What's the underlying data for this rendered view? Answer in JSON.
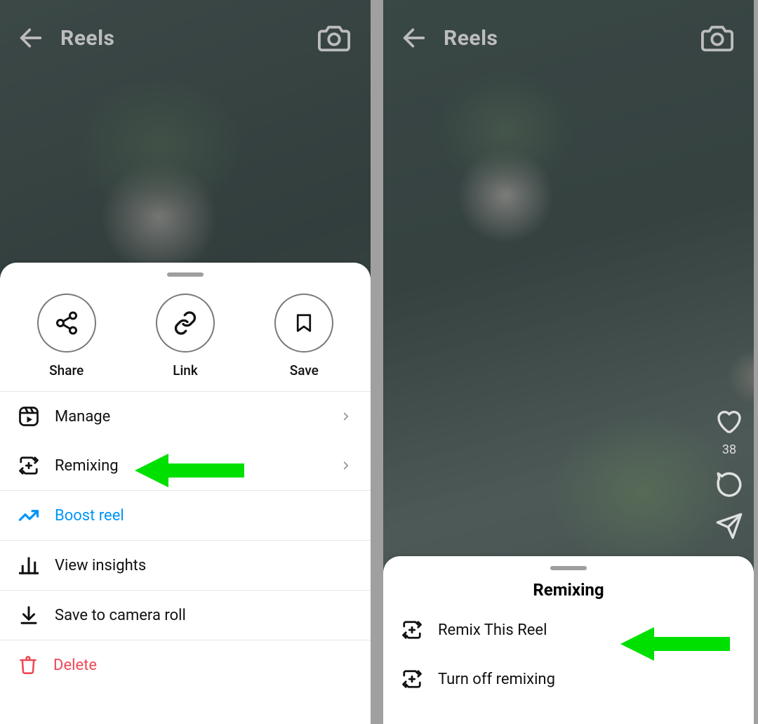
{
  "left": {
    "header": {
      "title": "Reels"
    },
    "sheet": {
      "actions": {
        "share": "Share",
        "link": "Link",
        "save": "Save"
      },
      "menu": {
        "manage": "Manage",
        "remixing": "Remixing",
        "boost": "Boost reel",
        "insights": "View insights",
        "save_roll": "Save to camera roll",
        "delete": "Delete"
      }
    }
  },
  "right": {
    "header": {
      "title": "Reels"
    },
    "rail": {
      "likes": "38"
    },
    "sheet": {
      "title": "Remixing",
      "menu": {
        "remix_this": "Remix This Reel",
        "turn_off": "Turn off remixing"
      }
    }
  }
}
